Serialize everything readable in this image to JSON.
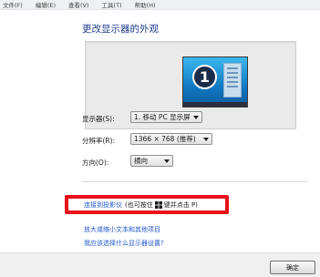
{
  "menubar": {
    "items": [
      "文件(F)",
      "编辑(E)",
      "查看(V)",
      "工具(T)",
      "帮助(H)"
    ]
  },
  "heading": "更改显示器的外观",
  "preview": {
    "monitor_number": "1"
  },
  "settings": {
    "display_label": "显示器(S):",
    "display_value": "1. 移动 PC 显示屏",
    "resolution_label": "分辨率(R):",
    "resolution_value": "1366 × 768 (推荐)",
    "orientation_label": "方向(O):",
    "orientation_value": "横向"
  },
  "links": {
    "projector_link": "连接到投影仪",
    "projector_hint_prefix": "(也可按住",
    "projector_hint_suffix": "键并点击 P)",
    "text_size_link": "放大或缩小文本和其他项目",
    "which_settings_link": "我应该选择什么显示器设置?"
  },
  "footer": {
    "ok_label": "确定"
  },
  "colors": {
    "link": "#1f56c9",
    "heading": "#1e3d8f",
    "highlight": "#e8101a",
    "monitor_blue": "#1278c2"
  }
}
